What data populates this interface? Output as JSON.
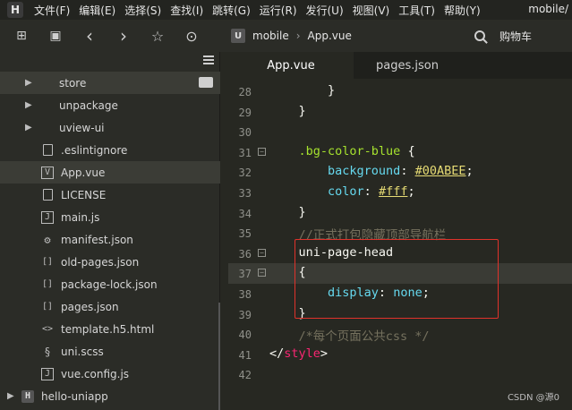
{
  "app": {
    "logo_letter": "H",
    "menu": [
      "文件(F)",
      "编辑(E)",
      "选择(S)",
      "查找(I)",
      "跳转(G)",
      "运行(R)",
      "发行(U)",
      "视图(V)",
      "工具(T)",
      "帮助(Y)"
    ],
    "window_title": "mobile/"
  },
  "toolbar": {
    "icons": [
      "new-file-icon",
      "save-icon",
      "back-icon",
      "forward-icon",
      "bookmark-icon",
      "run-icon"
    ],
    "glyphs": [
      "⊞",
      "▣",
      "‹",
      "›",
      "☆",
      "⊙"
    ],
    "breadcrumb": {
      "logo_letter": "U",
      "project": "mobile",
      "file": "App.vue",
      "separator": "›"
    },
    "search_label": "购物车"
  },
  "sidebar": {
    "items": [
      {
        "label": "store",
        "type": "folder",
        "expanded": false,
        "selected": true
      },
      {
        "label": "unpackage",
        "type": "folder",
        "expanded": false,
        "selected": false
      },
      {
        "label": "uview-ui",
        "type": "folder",
        "expanded": false,
        "selected": false
      },
      {
        "label": ".eslintignore",
        "type": "file",
        "icon_glyph": "",
        "selected": false
      },
      {
        "label": "App.vue",
        "type": "vue",
        "icon_glyph": "V",
        "selected": true
      },
      {
        "label": "LICENSE",
        "type": "file",
        "icon_glyph": "",
        "selected": false
      },
      {
        "label": "main.js",
        "type": "js",
        "icon_glyph": "J",
        "selected": false
      },
      {
        "label": "manifest.json",
        "type": "manifest",
        "icon_glyph": "⚙",
        "selected": false
      },
      {
        "label": "old-pages.json",
        "type": "json",
        "icon_glyph": "[]",
        "selected": false
      },
      {
        "label": "package-lock.json",
        "type": "json",
        "icon_glyph": "[]",
        "selected": false
      },
      {
        "label": "pages.json",
        "type": "json",
        "icon_glyph": "[]",
        "selected": false
      },
      {
        "label": "template.h5.html",
        "type": "html",
        "icon_glyph": "<>",
        "selected": false
      },
      {
        "label": "uni.scss",
        "type": "scss",
        "icon_glyph": "§",
        "selected": false
      },
      {
        "label": "vue.config.js",
        "type": "js",
        "icon_glyph": "J",
        "selected": false
      },
      {
        "label": "hello-uniapp",
        "type": "project",
        "icon_glyph": "H",
        "selected": false
      }
    ]
  },
  "tabs": [
    {
      "label": "App.vue",
      "active": true
    },
    {
      "label": "pages.json",
      "active": false
    }
  ],
  "editor": {
    "lines": [
      {
        "num": "28",
        "fold": "",
        "tokens": [
          {
            "t": "        }",
            "c": "punct"
          }
        ]
      },
      {
        "num": "29",
        "fold": "",
        "tokens": [
          {
            "t": "    }",
            "c": "punct"
          }
        ]
      },
      {
        "num": "30",
        "fold": "",
        "tokens": []
      },
      {
        "num": "31",
        "fold": "⊟",
        "tokens": [
          {
            "t": "    .bg-color-blue ",
            "c": "sel"
          },
          {
            "t": "{",
            "c": "punct"
          }
        ]
      },
      {
        "num": "32",
        "fold": "",
        "tokens": [
          {
            "t": "        background",
            "c": "prop"
          },
          {
            "t": ": ",
            "c": "punct"
          },
          {
            "t": "#00ABEE",
            "c": "hex"
          },
          {
            "t": ";",
            "c": "punct"
          }
        ]
      },
      {
        "num": "33",
        "fold": "",
        "tokens": [
          {
            "t": "        color",
            "c": "prop"
          },
          {
            "t": ": ",
            "c": "punct"
          },
          {
            "t": "#fff",
            "c": "hex"
          },
          {
            "t": ";",
            "c": "punct"
          }
        ]
      },
      {
        "num": "34",
        "fold": "",
        "tokens": [
          {
            "t": "    }",
            "c": "punct"
          }
        ]
      },
      {
        "num": "35",
        "fold": "",
        "tokens": [
          {
            "t": "    //正式打包隐藏顶部导航栏",
            "c": "comment"
          }
        ]
      },
      {
        "num": "36",
        "fold": "⊟",
        "tokens": [
          {
            "t": "    uni-page-head",
            "c": "plain"
          }
        ]
      },
      {
        "num": "37",
        "fold": "⊟",
        "current": true,
        "tokens": [
          {
            "t": "    ",
            "c": "plain"
          },
          {
            "t": "{",
            "c": "punct"
          }
        ]
      },
      {
        "num": "38",
        "fold": "",
        "tokens": [
          {
            "t": "        display",
            "c": "prop"
          },
          {
            "t": ": ",
            "c": "punct"
          },
          {
            "t": "none",
            "c": "val"
          },
          {
            "t": ";",
            "c": "punct"
          }
        ]
      },
      {
        "num": "39",
        "fold": "",
        "tokens": [
          {
            "t": "    }",
            "c": "punct"
          }
        ]
      },
      {
        "num": "40",
        "fold": "",
        "tokens": [
          {
            "t": "    /*每个页面公共css */",
            "c": "comment"
          }
        ]
      },
      {
        "num": "41",
        "fold": "",
        "tokens": [
          {
            "t": "</",
            "c": "punct"
          },
          {
            "t": "style",
            "c": "tag"
          },
          {
            "t": ">",
            "c": "punct"
          }
        ]
      },
      {
        "num": "42",
        "fold": "",
        "tokens": []
      }
    ]
  },
  "watermark": "CSDN @源0"
}
